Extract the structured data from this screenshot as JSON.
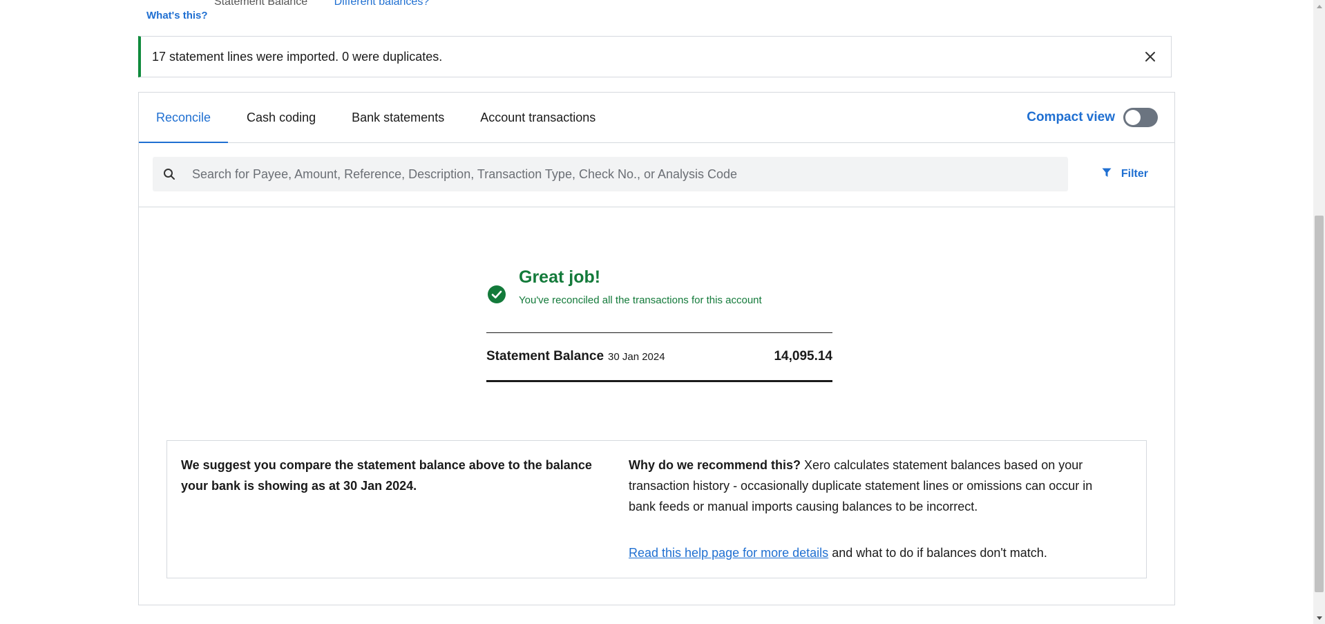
{
  "header": {
    "cut_left_text": "Statement Balance",
    "cut_link_text": "Different balances?",
    "whats_this": "What's this?"
  },
  "banner": {
    "message": "17 statement lines were imported. 0 were duplicates.",
    "close_icon": "close-icon"
  },
  "tabs": [
    {
      "label": "Reconcile",
      "active": true
    },
    {
      "label": "Cash coding",
      "active": false
    },
    {
      "label": "Bank statements",
      "active": false
    },
    {
      "label": "Account transactions",
      "active": false
    }
  ],
  "compact_view": {
    "label": "Compact view",
    "enabled": false
  },
  "search": {
    "placeholder": "Search for Payee, Amount, Reference, Description, Transaction Type, Check No., or Analysis Code",
    "icon": "search-icon"
  },
  "filter": {
    "label": "Filter",
    "icon": "filter-icon"
  },
  "success": {
    "title": "Great job!",
    "subtitle": "You've reconciled all the transactions for this account",
    "icon": "check-circle-icon"
  },
  "statement": {
    "label": "Statement Balance",
    "date": "30 Jan 2024",
    "value": "14,095.14"
  },
  "suggestion": {
    "left_text": "We suggest you compare the statement balance above to the balance your bank is showing as at 30 Jan 2024.",
    "why_heading": "Why do we recommend this?",
    "why_text": "Xero calculates statement balances based on your transaction history - occasionally duplicate statement lines or omissions can occur in bank feeds or manual imports causing balances to be incorrect.",
    "help_link": "Read this help page for more details",
    "help_suffix": "and what to do if balances don't match."
  },
  "colors": {
    "accent": "#1f6fd1",
    "success": "#137a3a",
    "banner_bar": "#0f8a3c"
  }
}
